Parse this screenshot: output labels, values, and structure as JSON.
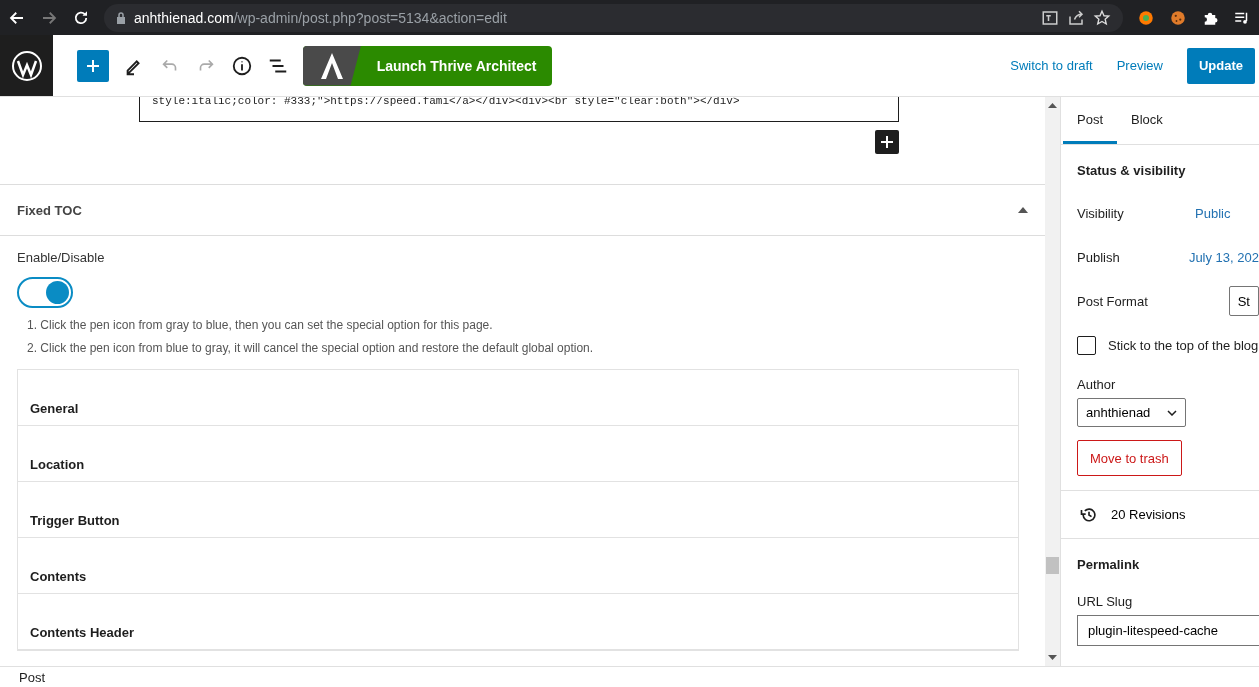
{
  "browser": {
    "url_host": "anhthienad.com",
    "url_path": "/wp-admin/post.php?post=5134&action=edit",
    "bookmarked": false
  },
  "toolbar": {
    "launch_button": "Launch Thrive Architect",
    "actions": [
      {
        "label": "Switch to draft",
        "kind": "link"
      },
      {
        "label": "Preview",
        "kind": "link"
      },
      {
        "label": "Update",
        "kind": "primary"
      }
    ]
  },
  "editor": {
    "code_line": "style:italic;color: #333;\">https://speed.fami</a></div><div><br style=\"clear:both\"></div>",
    "metabox": {
      "title": "Fixed TOC",
      "expanded": true,
      "toggle_label": "Enable/Disable",
      "toggle_on": true,
      "notes": [
        "1. Click the pen icon from gray to blue, then you can set the special option for this page.",
        "2. Click the pen icon from blue to gray, it will cancel the special option and restore the default global option."
      ],
      "sections": [
        "General",
        "Location",
        "Trigger Button",
        "Contents",
        "Contents Header"
      ]
    }
  },
  "sidebar": {
    "tabs": [
      {
        "label": "Post",
        "selected": true
      },
      {
        "label": "Block",
        "selected": false
      }
    ],
    "status_title": "Status & visibility",
    "rows": [
      {
        "label": "Visibility",
        "value": "Public",
        "kind": "link"
      },
      {
        "label": "Publish",
        "value": "July 13, 202",
        "kind": "link"
      },
      {
        "label": "Post Format",
        "value": "St",
        "kind": "select"
      }
    ],
    "sticky": {
      "label": "Stick to the top of the blog",
      "checked": false
    },
    "author_label": "Author",
    "author": "anhthienad",
    "trash": "Move to trash",
    "revisions": "20 Revisions",
    "permalink_title": "Permalink",
    "slug_label": "URL Slug",
    "slug": "plugin-litespeed-cache"
  },
  "status_bar": "Post"
}
